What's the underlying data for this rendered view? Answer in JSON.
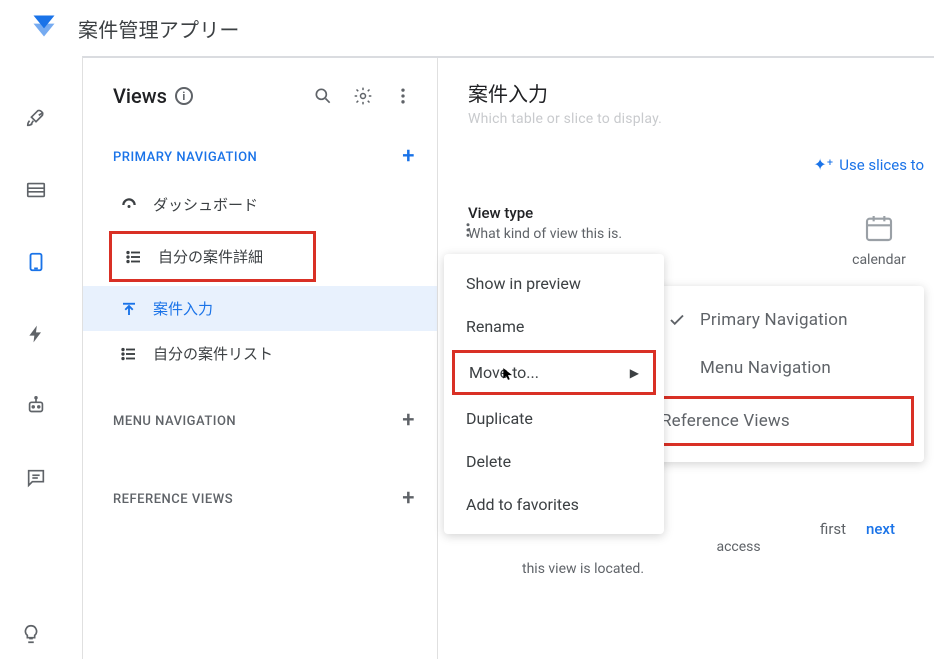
{
  "header": {
    "app_name": "案件管理アプリー"
  },
  "panel": {
    "title": "Views",
    "sections": {
      "primary": "PRIMARY NAVIGATION",
      "menu": "MENU NAVIGATION",
      "reference": "REFERENCE VIEWS"
    },
    "items": {
      "dashboard": "ダッシュボード",
      "my_case_detail": "自分の案件詳細",
      "case_input": "案件入力",
      "my_case_list": "自分の案件リスト"
    }
  },
  "right": {
    "title": "案件入力",
    "subtitle_faded": "Which table or slice to display.",
    "use_slices": "Use slices to",
    "view_type_title": "View type",
    "view_type_desc": "What kind of view this is.",
    "calendar_label": "calendar",
    "behind_text": "access this view is located.",
    "pos_first": "first",
    "pos_next": "next"
  },
  "ctx": {
    "show": "Show in preview",
    "rename": "Rename",
    "move": "Move to...",
    "duplicate": "Duplicate",
    "delete": "Delete",
    "fav": "Add to favorites"
  },
  "sub": {
    "primary": "Primary Navigation",
    "menu": "Menu Navigation",
    "reference": "Reference Views"
  },
  "icons": {
    "info": "i"
  }
}
